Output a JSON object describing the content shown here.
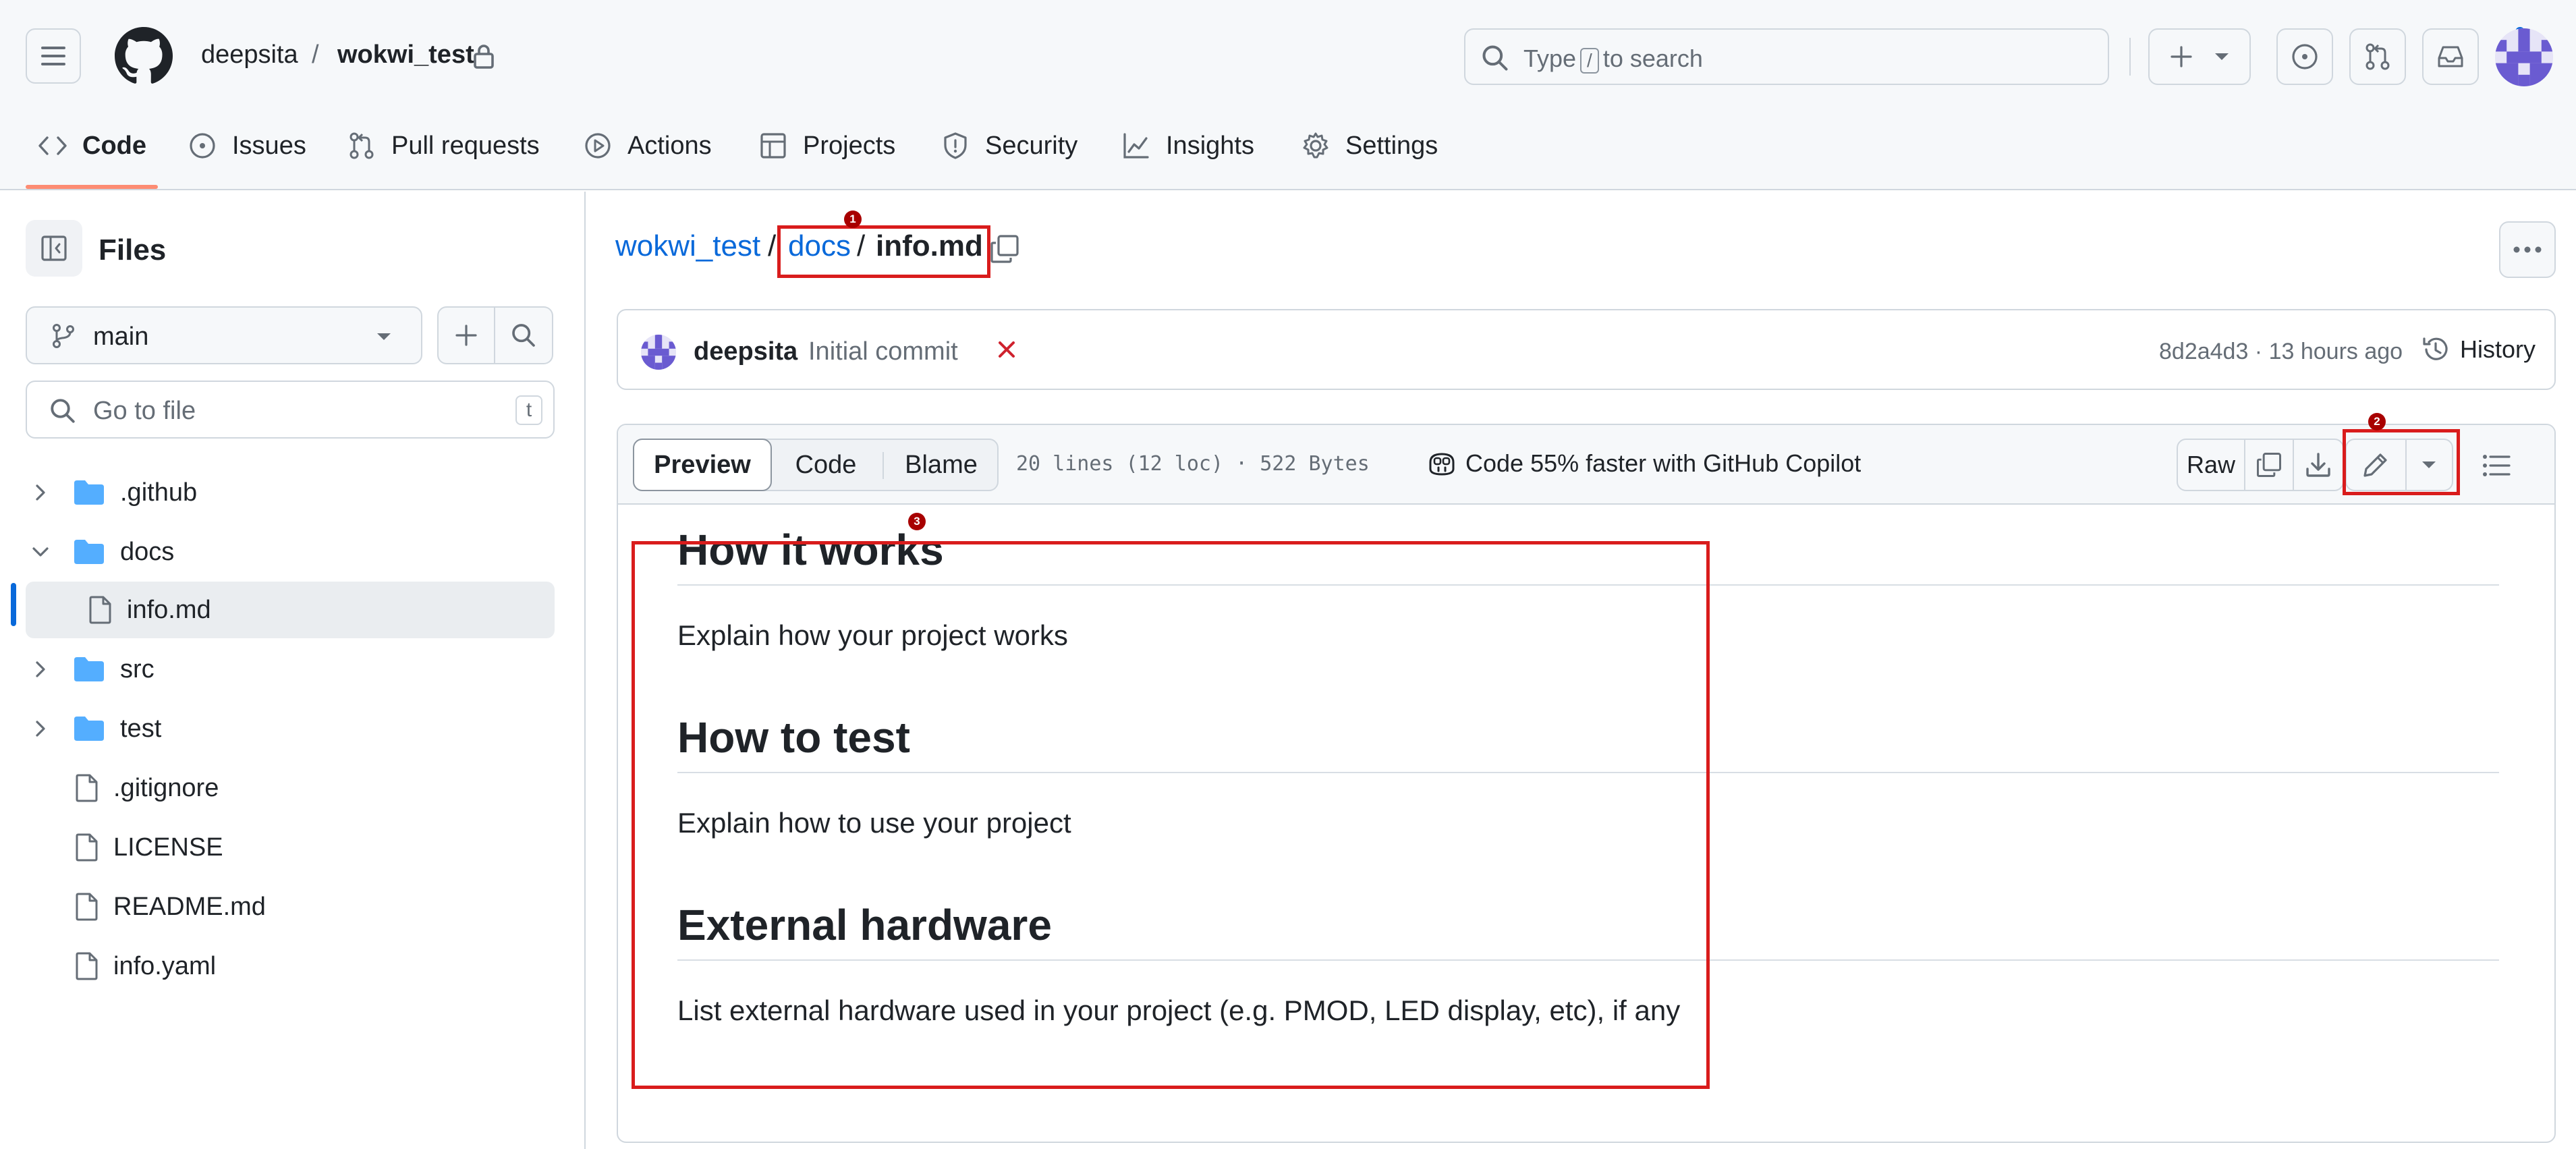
{
  "header": {
    "owner": "deepsita",
    "separator": "/",
    "repo": "wokwi_test",
    "search_prefix": "Type",
    "search_key": "/",
    "search_suffix": "to search"
  },
  "tabs": [
    {
      "label": "Code",
      "icon": "code-icon"
    },
    {
      "label": "Issues",
      "icon": "issue-icon"
    },
    {
      "label": "Pull requests",
      "icon": "pull-request-icon"
    },
    {
      "label": "Actions",
      "icon": "play-icon"
    },
    {
      "label": "Projects",
      "icon": "table-icon"
    },
    {
      "label": "Security",
      "icon": "shield-icon"
    },
    {
      "label": "Insights",
      "icon": "graph-icon"
    },
    {
      "label": "Settings",
      "icon": "gear-icon"
    }
  ],
  "sidebar": {
    "title": "Files",
    "branch": "main",
    "go_to_file": "Go to file",
    "go_to_file_key": "t",
    "tree": [
      {
        "label": ".github",
        "type": "folder",
        "expanded": false
      },
      {
        "label": "docs",
        "type": "folder",
        "expanded": true
      },
      {
        "label": "info.md",
        "type": "file",
        "selected": true
      },
      {
        "label": "src",
        "type": "folder",
        "expanded": false
      },
      {
        "label": "test",
        "type": "folder",
        "expanded": false
      },
      {
        "label": ".gitignore",
        "type": "file"
      },
      {
        "label": "LICENSE",
        "type": "file"
      },
      {
        "label": "README.md",
        "type": "file"
      },
      {
        "label": "info.yaml",
        "type": "file"
      }
    ]
  },
  "breadcrumb": {
    "repo": "wokwi_test",
    "sep1": "/",
    "folder": "docs",
    "sep2": "/",
    "file": "info.md"
  },
  "commit": {
    "author": "deepsita",
    "message": "Initial commit",
    "status": "failed",
    "meta": "8d2a4d3 · 13 hours ago",
    "history": "History"
  },
  "file_toolbar": {
    "views": [
      "Preview",
      "Code",
      "Blame"
    ],
    "active_view": "Preview",
    "info": "20 lines (12 loc) · 522 Bytes",
    "copilot": "Code 55% faster with GitHub Copilot",
    "raw": "Raw"
  },
  "markdown": {
    "h1": "How it works",
    "p1": "Explain how your project works",
    "h2": "How to test",
    "p2": "Explain how to use your project",
    "h3": "External hardware",
    "p3": "List external hardware used in your project (e.g. PMOD, LED display, etc), if any"
  },
  "annotations": [
    "1",
    "2",
    "3"
  ],
  "colors": {
    "accent": "#0969da",
    "tab_underline": "#fd8c73",
    "error": "#cf222e",
    "annotation": "#d91c1c",
    "header_bg": "#f6f8fa"
  }
}
